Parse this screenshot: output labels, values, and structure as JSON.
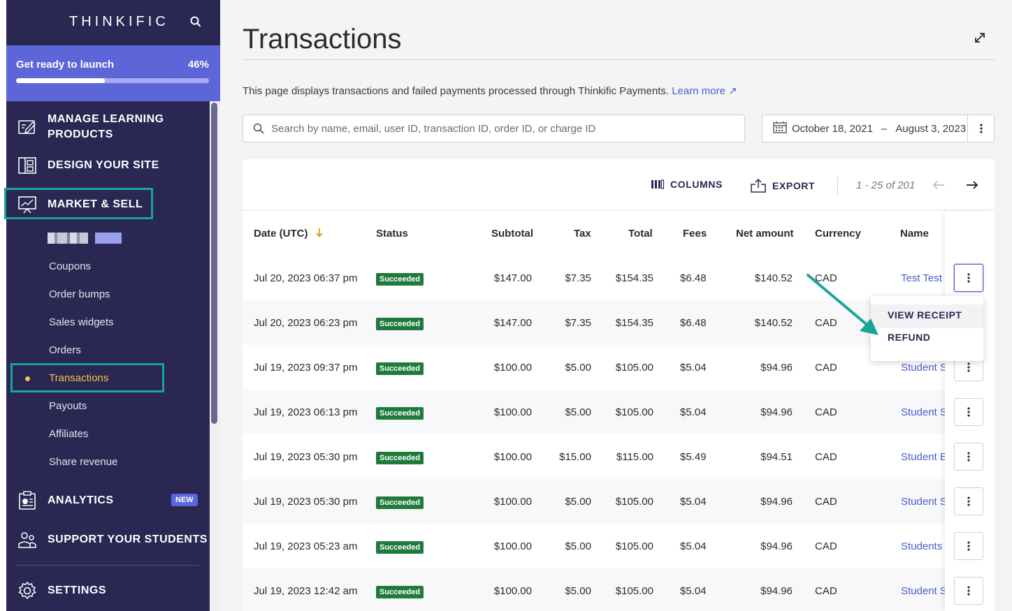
{
  "sidebar": {
    "logo": "THINKIFIC",
    "launch": {
      "label": "Get ready to launch",
      "percent_text": "46%",
      "progress": 0.46
    },
    "main_items": [
      {
        "label_line1": "MANAGE LEARNING",
        "label_line2": "PRODUCTS",
        "icon": "edit-board-icon"
      },
      {
        "label": "DESIGN YOUR SITE",
        "icon": "layout-icon"
      },
      {
        "label": "MARKET & SELL",
        "icon": "presentation-chart-icon"
      },
      {
        "label": "ANALYTICS",
        "icon": "clipboard-chart-icon",
        "badge": "NEW"
      },
      {
        "label": "SUPPORT YOUR STUDENTS",
        "icon": "people-icon"
      },
      {
        "label": "SETTINGS",
        "icon": "gear-icon"
      }
    ],
    "sub_items": [
      "Coupons",
      "Order bumps",
      "Sales widgets",
      "Orders",
      "Transactions",
      "Payouts",
      "Affiliates",
      "Share revenue"
    ],
    "active_sub": "Transactions"
  },
  "page": {
    "title": "Transactions",
    "description": "This page displays transactions and failed payments processed through Thinkific Payments.",
    "learn_more": "Learn more ↗"
  },
  "search": {
    "placeholder": "Search by name, email, user ID, transaction ID, order ID, or charge ID"
  },
  "date_range": {
    "start": "October 18, 2021",
    "separator": "–",
    "end": "August 3, 2023"
  },
  "toolbar": {
    "columns": "COLUMNS",
    "export": "EXPORT",
    "pager": "1 - 25 of 201"
  },
  "table": {
    "headers": {
      "date": "Date (UTC)",
      "status": "Status",
      "subtotal": "Subtotal",
      "tax": "Tax",
      "total": "Total",
      "fees": "Fees",
      "net": "Net amount",
      "currency": "Currency",
      "name": "Name"
    },
    "rows": [
      {
        "date": "Jul 20, 2023 06:37 pm",
        "status": "Succeeded",
        "subtotal": "$147.00",
        "tax": "$7.35",
        "total": "$154.35",
        "fees": "$6.48",
        "net": "$140.52",
        "currency": "CAD",
        "name": "Test Test"
      },
      {
        "date": "Jul 20, 2023 06:23 pm",
        "status": "Succeeded",
        "subtotal": "$147.00",
        "tax": "$7.35",
        "total": "$154.35",
        "fees": "$6.48",
        "net": "$140.52",
        "currency": "CAD",
        "name": ""
      },
      {
        "date": "Jul 19, 2023 09:37 pm",
        "status": "Succeeded",
        "subtotal": "$100.00",
        "tax": "$5.00",
        "total": "$105.00",
        "fees": "$5.04",
        "net": "$94.96",
        "currency": "CAD",
        "name": "Student S"
      },
      {
        "date": "Jul 19, 2023 06:13 pm",
        "status": "Succeeded",
        "subtotal": "$100.00",
        "tax": "$5.00",
        "total": "$105.00",
        "fees": "$5.04",
        "net": "$94.96",
        "currency": "CAD",
        "name": "Student S"
      },
      {
        "date": "Jul 19, 2023 05:30 pm",
        "status": "Succeeded",
        "subtotal": "$100.00",
        "tax": "$15.00",
        "total": "$115.00",
        "fees": "$5.49",
        "net": "$94.51",
        "currency": "CAD",
        "name": "Student E"
      },
      {
        "date": "Jul 19, 2023 05:30 pm",
        "status": "Succeeded",
        "subtotal": "$100.00",
        "tax": "$5.00",
        "total": "$105.00",
        "fees": "$5.04",
        "net": "$94.96",
        "currency": "CAD",
        "name": "Student S"
      },
      {
        "date": "Jul 19, 2023 05:23 am",
        "status": "Succeeded",
        "subtotal": "$100.00",
        "tax": "$5.00",
        "total": "$105.00",
        "fees": "$5.04",
        "net": "$94.96",
        "currency": "CAD",
        "name": "Students"
      },
      {
        "date": "Jul 19, 2023 12:42 am",
        "status": "Succeeded",
        "subtotal": "$100.00",
        "tax": "$5.00",
        "total": "$105.00",
        "fees": "$5.04",
        "net": "$94.96",
        "currency": "CAD",
        "name": "Student S"
      }
    ]
  },
  "row_menu": {
    "view_receipt": "VIEW RECEIPT",
    "refund": "REFUND"
  },
  "colors": {
    "sidebar_bg": "#2a2753",
    "accent": "#5d66d9",
    "highlight": "#1ba597",
    "active_sub": "#f5c34b",
    "status_success": "#1f7a3d",
    "link": "#4a5cc9"
  }
}
